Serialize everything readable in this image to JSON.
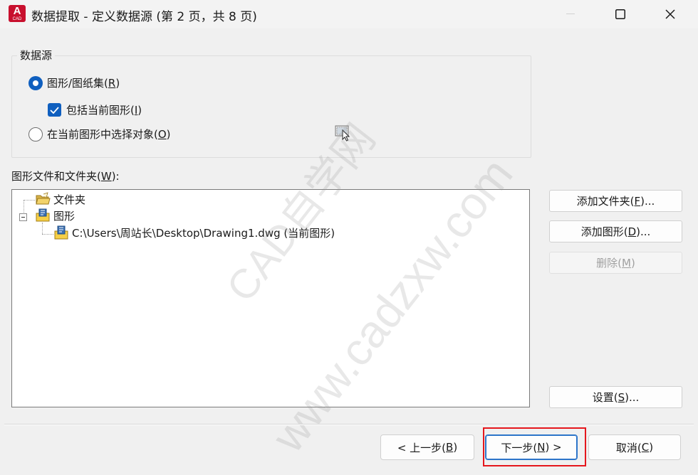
{
  "window": {
    "title": "数据提取 - 定义数据源 (第 2 页，共 8 页)",
    "app_icon_letter": "A",
    "app_icon_sub": "CAD"
  },
  "data_source": {
    "group_label": "数据源",
    "option_sheets": {
      "label": "图形/图纸集(",
      "key": "R",
      "end": ")",
      "selected": true
    },
    "include_current": {
      "label": "包括当前图形(",
      "key": "I",
      "end": ")",
      "checked": true
    },
    "option_select": {
      "label": "在当前图形中选择对象(",
      "key": "O",
      "end": ")",
      "selected": false
    }
  },
  "files": {
    "label_prefix": "图形文件和文件夹(",
    "label_key": "W",
    "label_suffix": "):",
    "tree": [
      {
        "label": "文件夹",
        "icon": "folder-icon"
      },
      {
        "label": "图形",
        "icon": "drawing-folder-icon"
      },
      {
        "label": "C:\\Users\\周站长\\Desktop\\Drawing1.dwg (当前图形)",
        "icon": "dwg-file-icon"
      }
    ]
  },
  "side_buttons": {
    "add_folder": {
      "label": "添加文件夹(",
      "key": "F",
      "end": ")..."
    },
    "add_drawing": {
      "label": "添加图形(",
      "key": "D",
      "end": ")..."
    },
    "delete": {
      "label": "删除(",
      "key": "M",
      "end": ")"
    },
    "settings": {
      "label": "设置(",
      "key": "S",
      "end": ")..."
    }
  },
  "bottom_buttons": {
    "back": {
      "label": "< 上一步(",
      "key": "B",
      "end": ")"
    },
    "next": {
      "label": "下一步(",
      "key": "N",
      "end": ") >"
    },
    "cancel": {
      "label": "取消(",
      "key": "C",
      "end": ")"
    }
  },
  "watermark": {
    "line1": "CAD自学网",
    "line2": "www.cadzxw.com"
  },
  "colors": {
    "accent": "#0f5fbf",
    "highlight": "#e5171d",
    "app_icon": "#c8102e"
  }
}
